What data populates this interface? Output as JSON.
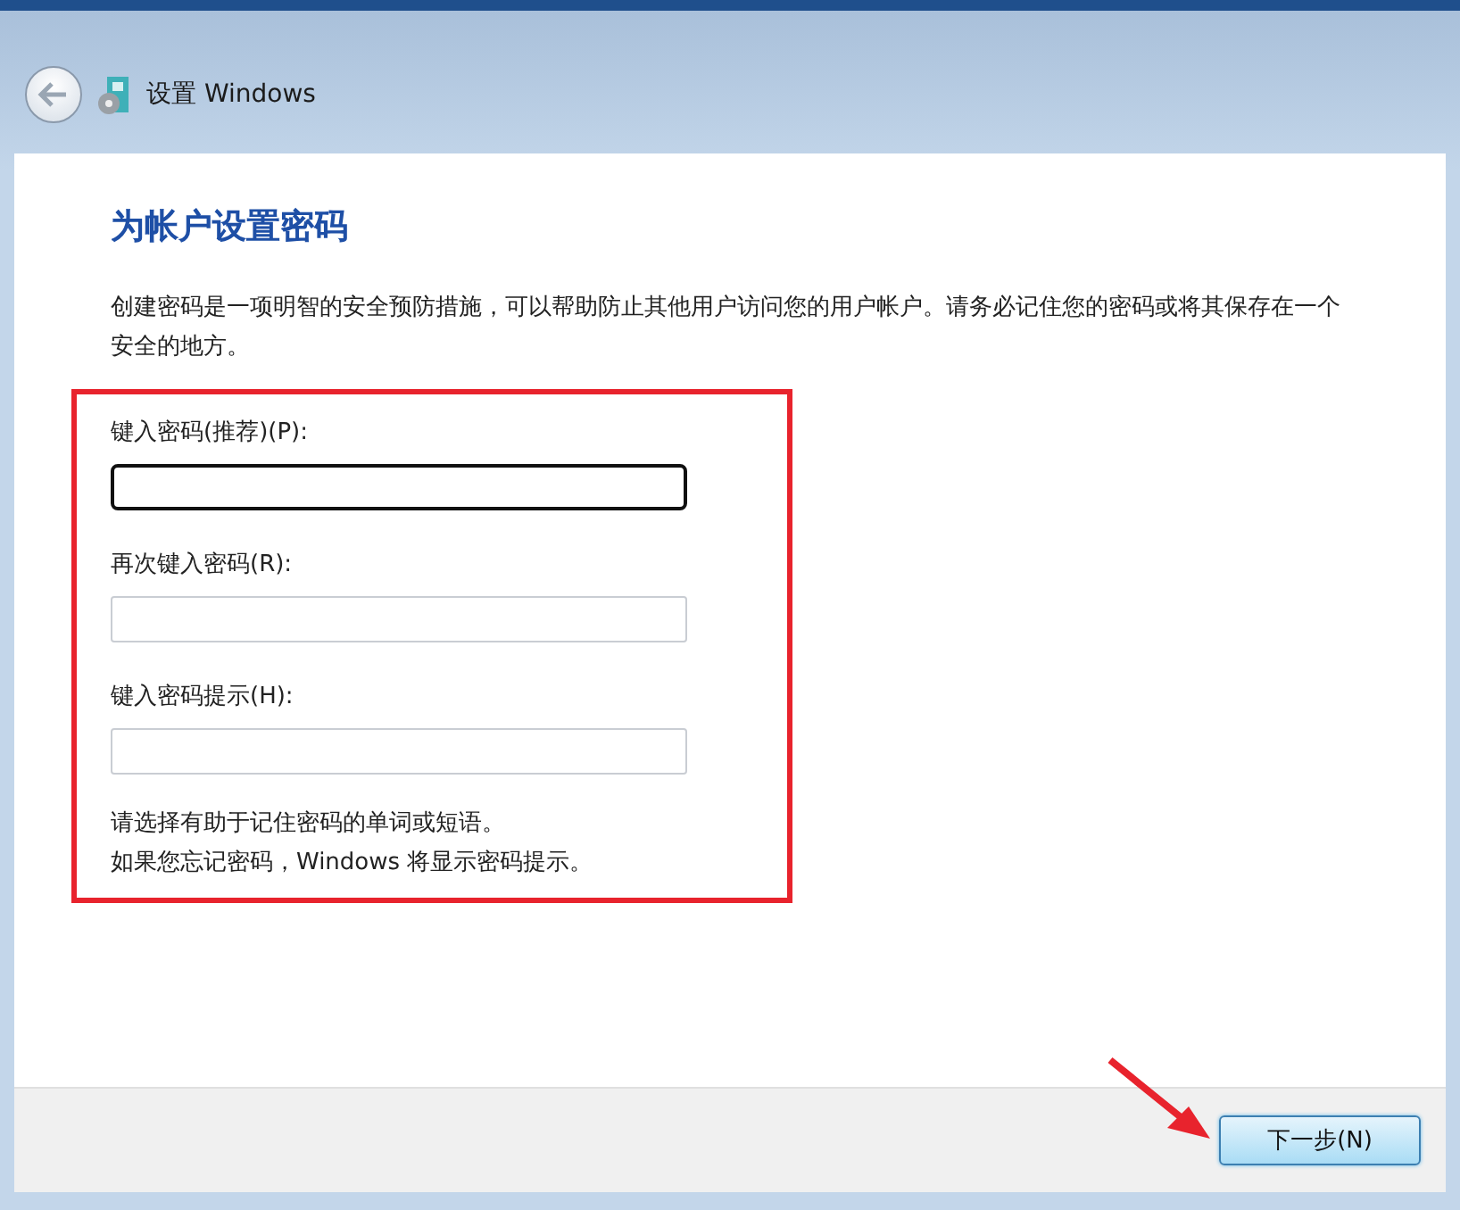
{
  "window": {
    "title": "设置 Windows"
  },
  "heading": "为帐户设置密码",
  "description": "创建密码是一项明智的安全预防措施，可以帮助防止其他用户访问您的用户帐户。请务必记住您的密码或将其保存在一个安全的地方。",
  "fields": [
    {
      "label": "键入密码(推荐)(P):",
      "focused": true
    },
    {
      "label": "再次键入密码(R):",
      "focused": false
    },
    {
      "label": "键入密码提示(H):",
      "focused": false
    }
  ],
  "hint_lines": [
    "请选择有助于记住密码的单词或短语。",
    "如果您忘记密码，Windows 将显示密码提示。"
  ],
  "buttons": [
    "下一步(N)"
  ]
}
